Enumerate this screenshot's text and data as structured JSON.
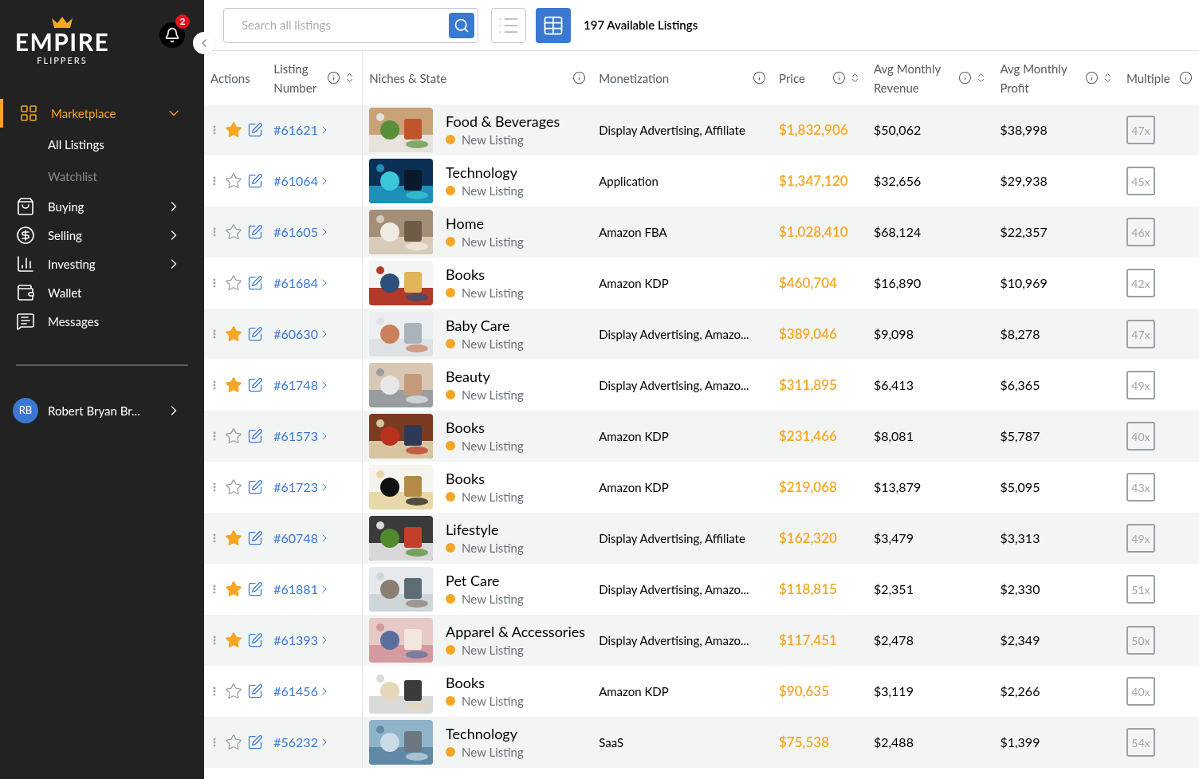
{
  "sidebar": {
    "logo": {
      "title": "EMPIRE",
      "subtitle": "FLIPPERS"
    },
    "notifications": {
      "count": "2"
    },
    "nav": [
      {
        "label": "Marketplace",
        "selected": true,
        "expanded": true,
        "children": [
          {
            "label": "All Listings",
            "selected": true
          },
          {
            "label": "Watchlist",
            "selected": false
          }
        ]
      },
      {
        "label": "Buying",
        "selected": false,
        "expanded": false
      },
      {
        "label": "Selling",
        "selected": false,
        "expanded": false
      },
      {
        "label": "Investing",
        "selected": false,
        "expanded": false
      },
      {
        "label": "Wallet",
        "selected": false
      },
      {
        "label": "Messages",
        "selected": false
      }
    ],
    "user": {
      "initials": "RB",
      "name": "Robert Bryan Br..."
    }
  },
  "toolbar": {
    "search": {
      "placeholder": "Search all listings"
    },
    "views": [
      {
        "kind": "list",
        "selected": false
      },
      {
        "kind": "table",
        "selected": true
      }
    ],
    "count": "197 Available Listings"
  },
  "table": {
    "columns": [
      {
        "label": "Actions",
        "info": false,
        "sort": false
      },
      {
        "label": "Listing Number",
        "info": true,
        "sort": true
      },
      {
        "label": "Niches & State",
        "info": true,
        "sort": false
      },
      {
        "label": "Monetization",
        "info": true,
        "sort": false
      },
      {
        "label": "Price",
        "info": true,
        "sort": true
      },
      {
        "label": "Avg Monthly Revenue",
        "info": true,
        "sort": true
      },
      {
        "label": "Avg Monthly Profit",
        "info": true,
        "sort": true
      },
      {
        "label": "Multiple",
        "info": true,
        "sort": false
      }
    ],
    "rows": [
      {
        "starred": true,
        "number": "#61621",
        "niche": "Food & Beverages",
        "state": "New Listing",
        "monetization": "Display Advertising, Affiliate",
        "price": "$1,832,906",
        "revenue": "$50,062",
        "profit": "$38,998",
        "multiple": "47x"
      },
      {
        "starred": false,
        "number": "#61064",
        "niche": "Technology",
        "state": "New Listing",
        "monetization": "Application",
        "price": "$1,347,120",
        "revenue": "$32,656",
        "profit": "$29,938",
        "multiple": "45x"
      },
      {
        "starred": false,
        "number": "#61605",
        "niche": "Home",
        "state": "New Listing",
        "monetization": "Amazon FBA",
        "price": "$1,028,410",
        "revenue": "$68,124",
        "profit": "$22,357",
        "multiple": "46x"
      },
      {
        "starred": false,
        "number": "#61684",
        "niche": "Books",
        "state": "New Listing",
        "monetization": "Amazon KDP",
        "price": "$460,704",
        "revenue": "$16,890",
        "profit": "$10,969",
        "multiple": "42x"
      },
      {
        "starred": true,
        "number": "#60630",
        "niche": "Baby Care",
        "state": "New Listing",
        "monetization": "Display Advertising, Amazo...",
        "price": "$389,046",
        "revenue": "$9,098",
        "profit": "$8,278",
        "multiple": "47x"
      },
      {
        "starred": true,
        "number": "#61748",
        "niche": "Beauty",
        "state": "New Listing",
        "monetization": "Display Advertising, Amazo...",
        "price": "$311,895",
        "revenue": "$6,413",
        "profit": "$6,365",
        "multiple": "49x"
      },
      {
        "starred": false,
        "number": "#61573",
        "niche": "Books",
        "state": "New Listing",
        "monetization": "Amazon KDP",
        "price": "$231,466",
        "revenue": "$8,081",
        "profit": "$5,787",
        "multiple": "40x"
      },
      {
        "starred": false,
        "number": "#61723",
        "niche": "Books",
        "state": "New Listing",
        "monetization": "Amazon KDP",
        "price": "$219,068",
        "revenue": "$13,879",
        "profit": "$5,095",
        "multiple": "43x"
      },
      {
        "starred": true,
        "number": "#60748",
        "niche": "Lifestyle",
        "state": "New Listing",
        "monetization": "Display Advertising, Affiliate",
        "price": "$162,320",
        "revenue": "$3,479",
        "profit": "$3,313",
        "multiple": "49x"
      },
      {
        "starred": true,
        "number": "#61881",
        "niche": "Pet Care",
        "state": "New Listing",
        "monetization": "Display Advertising, Amazo...",
        "price": "$118,815",
        "revenue": "$2,351",
        "profit": "$2,330",
        "multiple": "51x"
      },
      {
        "starred": true,
        "number": "#61393",
        "niche": "Apparel & Accessories",
        "state": "New Listing",
        "monetization": "Display Advertising, Amazo...",
        "price": "$117,451",
        "revenue": "$2,478",
        "profit": "$2,349",
        "multiple": "50x"
      },
      {
        "starred": false,
        "number": "#61456",
        "niche": "Books",
        "state": "New Listing",
        "monetization": "Amazon KDP",
        "price": "$90,635",
        "revenue": "$3,119",
        "profit": "$2,266",
        "multiple": "40x"
      },
      {
        "starred": false,
        "number": "#56232",
        "niche": "Technology",
        "state": "New Listing",
        "monetization": "SaaS",
        "price": "$75,538",
        "revenue": "$2,488",
        "profit": "$1,399",
        "multiple": "54x"
      }
    ]
  }
}
